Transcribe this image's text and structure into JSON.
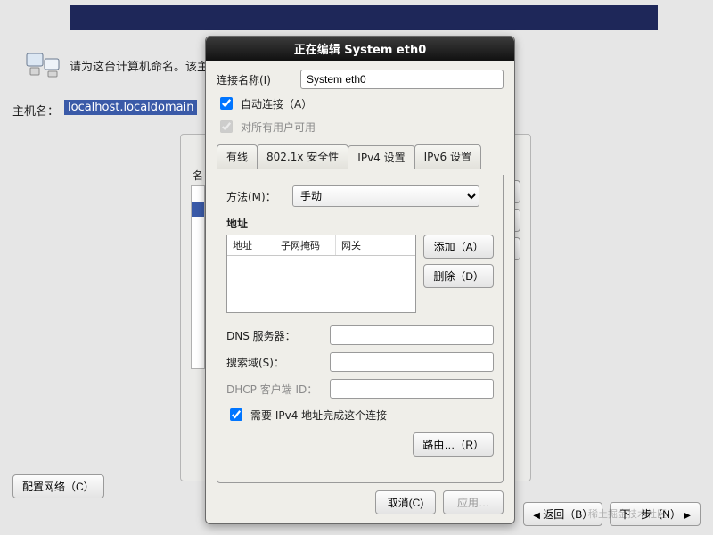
{
  "background": {
    "instruction": "请为这台计算机命名。该主…",
    "hostname_label": "主机名：",
    "hostname_value": "localhost.localdomain",
    "configure_network_btn": "配置网络（C）",
    "panel_name_col": "名",
    "back_btn": "返回（B）",
    "next_btn": "下一步（N）"
  },
  "dialog": {
    "title": "正在编辑 System eth0",
    "conn_name_label": "连接名称(I)",
    "conn_name_value": "System eth0",
    "autoconnect_label": "自动连接（A）",
    "autoconnect_checked": true,
    "all_users_label": "对所有用户可用",
    "all_users_checked": true,
    "tabs": [
      "有线",
      "802.1x 安全性",
      "IPv4 设置",
      "IPv6 设置"
    ],
    "active_tab_index": 2,
    "ipv4": {
      "method_label": "方法(M)：",
      "method_value": "手动",
      "addresses_label": "地址",
      "table_headers": [
        "地址",
        "子网掩码",
        "网关"
      ],
      "add_btn": "添加（A）",
      "delete_btn": "删除（D）",
      "dns_label": "DNS 服务器：",
      "dns_value": "",
      "search_label": "搜索域(S)：",
      "search_value": "",
      "dhcp_id_label": "DHCP 客户端 ID：",
      "dhcp_id_value": "",
      "require_ipv4_label": "需要 IPv4 地址完成这个连接",
      "require_ipv4_checked": true,
      "routes_btn": "路由…（R）"
    },
    "cancel_btn": "取消(C)",
    "apply_btn": "应用…"
  },
  "watermark": "稀土掘金技术社区"
}
